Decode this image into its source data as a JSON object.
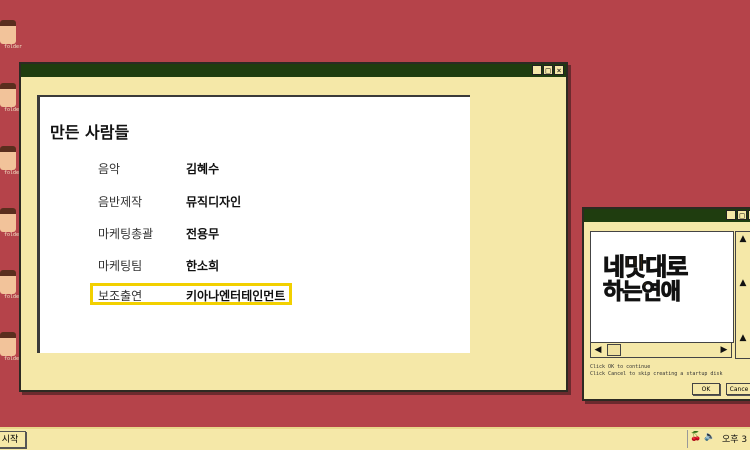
{
  "desktop": {
    "icons": [
      {
        "label": "folder"
      },
      {
        "label": "folder"
      },
      {
        "label": "folder"
      },
      {
        "label": "folder"
      },
      {
        "label": "folder"
      },
      {
        "label": "folder"
      }
    ]
  },
  "main_window": {
    "buttons": {
      "minimize": "_",
      "maximize": "□",
      "close": "×"
    },
    "heading": "만든 사람들",
    "credits": [
      {
        "role": "음악",
        "name": "김혜수"
      },
      {
        "role": "음반제작",
        "name": "뮤직디자인"
      },
      {
        "role": "마케팅총괄",
        "name": "전용무"
      },
      {
        "role": "마케팅팀",
        "name": "한소희"
      },
      {
        "role": "보조출연",
        "name": "키아나엔터테인먼트"
      }
    ],
    "highlight_color": "#f2d000"
  },
  "ad_window": {
    "buttons": {
      "minimize": "_",
      "maximize": "□",
      "close": "×"
    },
    "logo_line1_a": "네",
    "logo_line1_accent": "맛",
    "logo_line1_b": "대로",
    "logo_line2_a": "하는",
    "logo_line2_accent": "연애",
    "messages": [
      "Click OK to continue",
      "Click Cancel to skip creating a startup disk"
    ],
    "ok_label": "OK",
    "cancel_label": "Cance"
  },
  "taskbar": {
    "start_label": "시작",
    "clock": "오후 3"
  },
  "colors": {
    "desktop": "#b5434a",
    "window": "#f5e8a8",
    "titlebar": "#1f3d0f",
    "accent": "#f39a1f"
  }
}
